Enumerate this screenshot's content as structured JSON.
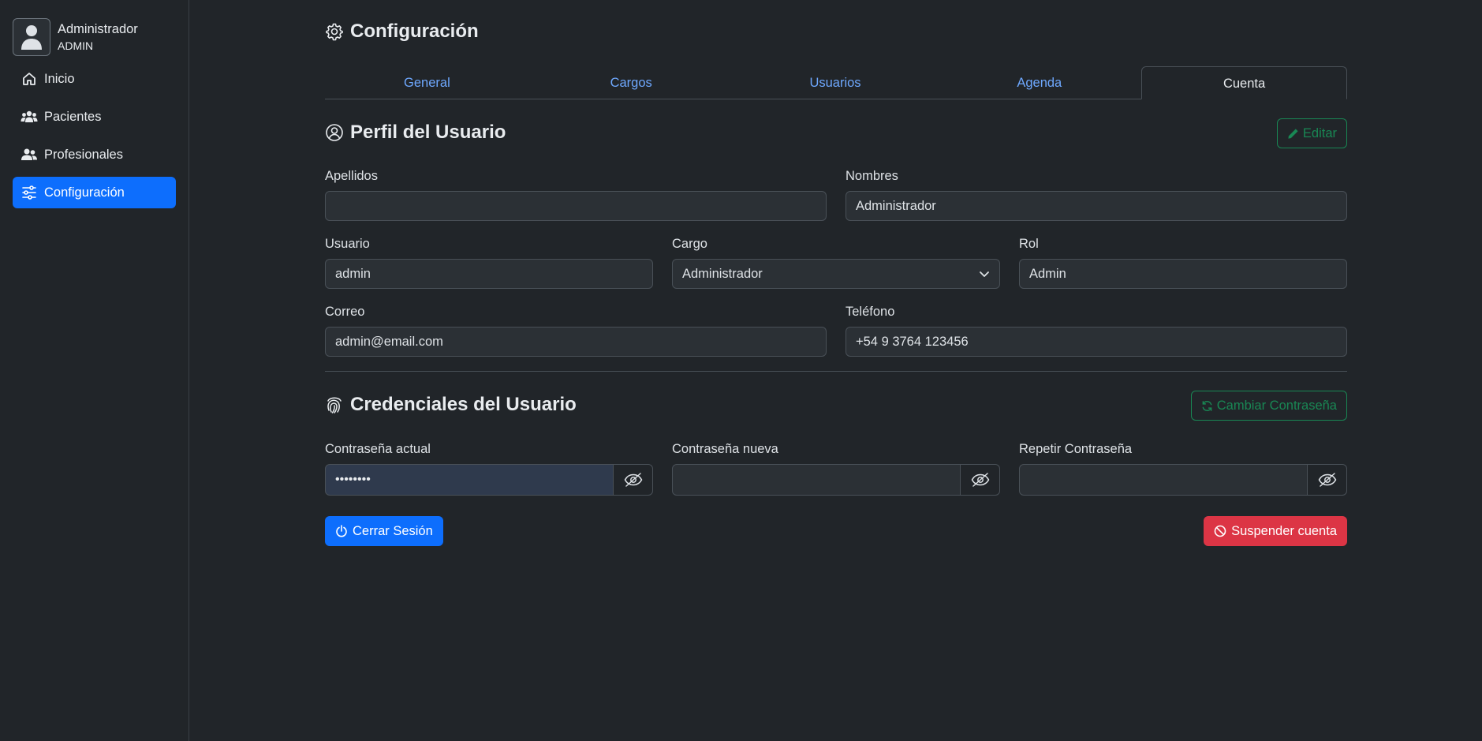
{
  "user": {
    "name": "Administrador",
    "role": "ADMIN"
  },
  "sidebar": {
    "items": [
      {
        "label": "Inicio",
        "icon": "house-icon"
      },
      {
        "label": "Pacientes",
        "icon": "people-icon"
      },
      {
        "label": "Profesionales",
        "icon": "person-group-icon"
      },
      {
        "label": "Configuración",
        "icon": "sliders-icon",
        "active": true
      }
    ]
  },
  "page": {
    "title": "Configuración"
  },
  "tabs": [
    {
      "label": "General"
    },
    {
      "label": "Cargos"
    },
    {
      "label": "Usuarios"
    },
    {
      "label": "Agenda"
    },
    {
      "label": "Cuenta",
      "active": true
    }
  ],
  "profile": {
    "title": "Perfil del Usuario",
    "edit_label": "Editar",
    "fields": {
      "apellidos": {
        "label": "Apellidos",
        "value": ""
      },
      "nombres": {
        "label": "Nombres",
        "value": "Administrador"
      },
      "usuario": {
        "label": "Usuario",
        "value": "admin"
      },
      "cargo": {
        "label": "Cargo",
        "value": "Administrador"
      },
      "rol": {
        "label": "Rol",
        "value": "Admin"
      },
      "correo": {
        "label": "Correo",
        "value": "admin@email.com"
      },
      "telefono": {
        "label": "Teléfono",
        "value": "+54 9 3764 123456"
      }
    }
  },
  "credentials": {
    "title": "Credenciales del Usuario",
    "change_password_label": "Cambiar Contraseña",
    "fields": {
      "current": {
        "label": "Contraseña actual",
        "value": "••••••••"
      },
      "new": {
        "label": "Contraseña nueva",
        "value": ""
      },
      "repeat": {
        "label": "Repetir Contraseña",
        "value": ""
      }
    }
  },
  "actions": {
    "logout_label": "Cerrar Sesión",
    "suspend_label": "Suspender cuenta"
  },
  "colors": {
    "background": "#212529",
    "primary": "#0d6efd",
    "success": "#198754",
    "danger": "#dc3545",
    "tab_link": "#6ea8fe"
  }
}
